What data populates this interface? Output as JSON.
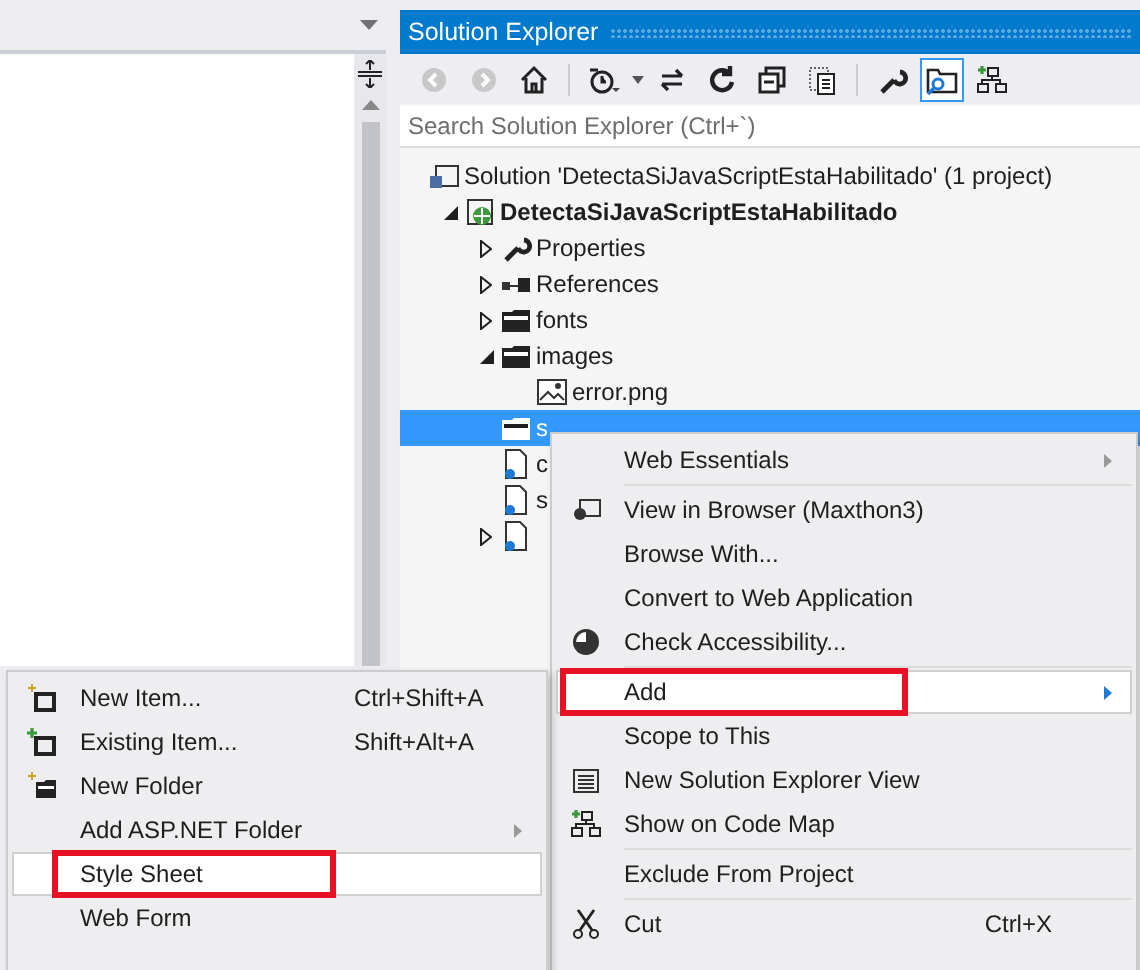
{
  "solution_explorer": {
    "title": "Solution Explorer",
    "toolbar": [
      {
        "kind": "back",
        "disabled": true,
        "selected": false
      },
      {
        "kind": "forward",
        "disabled": true,
        "selected": false
      },
      {
        "kind": "home",
        "selected": false
      },
      {
        "kind": "history",
        "selected": false
      },
      {
        "kind": "sync",
        "selected": false
      },
      {
        "kind": "refresh",
        "selected": false
      },
      {
        "kind": "collapse",
        "selected": false
      },
      {
        "kind": "show-all",
        "selected": false
      },
      {
        "kind": "properties",
        "selected": false
      },
      {
        "kind": "preview",
        "selected": true
      },
      {
        "kind": "code-map",
        "selected": false
      }
    ],
    "search": {
      "placeholder": "Search Solution Explorer (Ctrl+`)"
    },
    "tree": [
      {
        "label": "Solution 'DetectaSiJavaScriptEstaHabilitado' (1 project)",
        "kind": "solution",
        "selected": false,
        "children": [
          {
            "label": "DetectaSiJavaScriptEstaHabilitado",
            "kind": "project",
            "expanded": true,
            "selected": false,
            "children": [
              {
                "label": "Properties",
                "kind": "wrench",
                "expanded": false,
                "selected": false
              },
              {
                "label": "References",
                "kind": "references",
                "expanded": false,
                "selected": false
              },
              {
                "label": "fonts",
                "kind": "folder",
                "expanded": false,
                "selected": false
              },
              {
                "label": "images",
                "kind": "folder",
                "expanded": true,
                "selected": false,
                "children": [
                  {
                    "label": "error.png",
                    "kind": "image",
                    "selected": false
                  }
                ]
              },
              {
                "label": "s",
                "kind": "folder",
                "selected": true
              },
              {
                "label": "c",
                "kind": "file",
                "selected": false
              },
              {
                "label": "s",
                "kind": "file",
                "selected": false
              },
              {
                "kind": "file",
                "expanded": false,
                "selected": false
              }
            ]
          }
        ]
      }
    ]
  },
  "context_menu": [
    {
      "kind": "item",
      "label": "Web Essentials",
      "submenu": true,
      "selected": false,
      "annotated": false
    },
    {
      "kind": "separator"
    },
    {
      "kind": "item",
      "label": "View in Browser (Maxthon3)",
      "selected": false,
      "annotated": false
    },
    {
      "kind": "item",
      "label": "Browse With...",
      "selected": false,
      "annotated": false
    },
    {
      "kind": "item",
      "label": "Convert to Web Application",
      "selected": false,
      "annotated": false
    },
    {
      "kind": "item",
      "label": "Check Accessibility...",
      "selected": false,
      "annotated": false
    },
    {
      "kind": "separator"
    },
    {
      "kind": "item",
      "label": "Add",
      "submenu": true,
      "selected": true,
      "annotated": true
    },
    {
      "kind": "item",
      "label": "Scope to This",
      "selected": false,
      "annotated": false
    },
    {
      "kind": "item",
      "label": "New Solution Explorer View",
      "selected": false,
      "annotated": false
    },
    {
      "kind": "item",
      "label": "Show on Code Map",
      "selected": false,
      "annotated": false
    },
    {
      "kind": "separator"
    },
    {
      "kind": "item",
      "label": "Exclude From Project",
      "selected": false,
      "annotated": false
    },
    {
      "kind": "separator"
    },
    {
      "kind": "item",
      "label": "Cut",
      "shortcut": "Ctrl+X",
      "selected": false,
      "annotated": false
    }
  ],
  "add_submenu": [
    {
      "kind": "item",
      "label": "New Item...",
      "shortcut": "Ctrl+Shift+A",
      "selected": false,
      "annotated": false
    },
    {
      "kind": "item",
      "label": "Existing Item...",
      "shortcut": "Shift+Alt+A",
      "selected": false,
      "annotated": false
    },
    {
      "kind": "item",
      "label": "New Folder",
      "selected": false,
      "annotated": false
    },
    {
      "kind": "item",
      "label": "Add ASP.NET Folder",
      "submenu": true,
      "selected": false,
      "annotated": false
    },
    {
      "kind": "item",
      "label": "Style Sheet",
      "selected": true,
      "annotated": true
    },
    {
      "kind": "item",
      "label": "Web Form",
      "selected": false,
      "annotated": false
    }
  ]
}
